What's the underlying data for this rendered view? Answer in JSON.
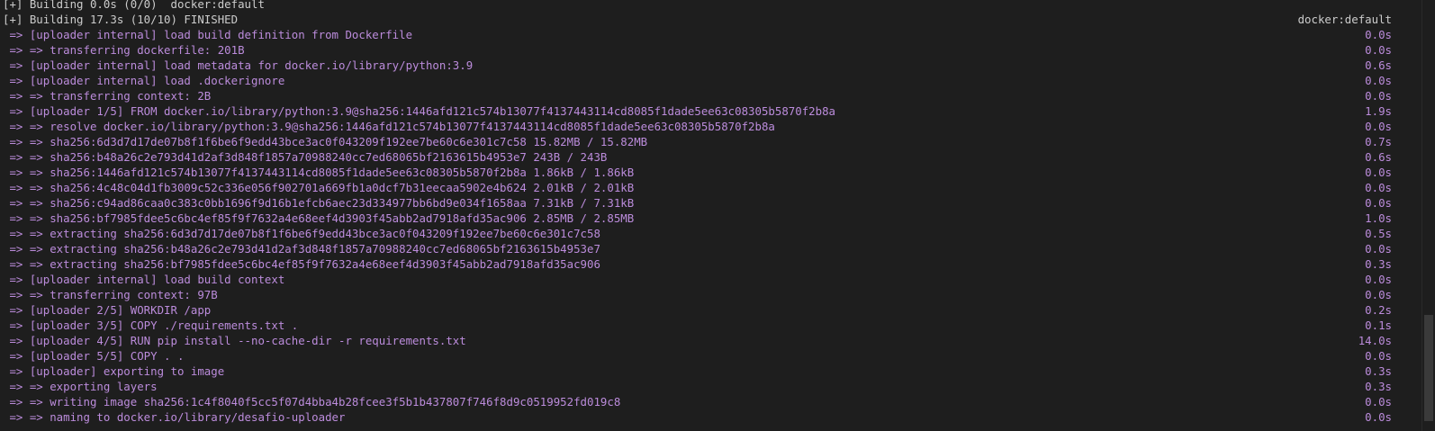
{
  "terminal": {
    "lines": [
      {
        "text": "[+] Building 0.0s (0/0)  docker:default",
        "time": "",
        "tone": "white"
      },
      {
        "text": "[+] Building 17.3s (10/10) FINISHED",
        "time": "docker:default",
        "tone": "white"
      },
      {
        "text": " => [uploader internal] load build definition from Dockerfile",
        "time": "0.0s",
        "tone": "purple"
      },
      {
        "text": " => => transferring dockerfile: 201B",
        "time": "0.0s",
        "tone": "purple"
      },
      {
        "text": " => [uploader internal] load metadata for docker.io/library/python:3.9",
        "time": "0.6s",
        "tone": "purple"
      },
      {
        "text": " => [uploader internal] load .dockerignore",
        "time": "0.0s",
        "tone": "purple"
      },
      {
        "text": " => => transferring context: 2B",
        "time": "0.0s",
        "tone": "purple"
      },
      {
        "text": " => [uploader 1/5] FROM docker.io/library/python:3.9@sha256:1446afd121c574b13077f4137443114cd8085f1dade5ee63c08305b5870f2b8a",
        "time": "1.9s",
        "tone": "purple"
      },
      {
        "text": " => => resolve docker.io/library/python:3.9@sha256:1446afd121c574b13077f4137443114cd8085f1dade5ee63c08305b5870f2b8a",
        "time": "0.0s",
        "tone": "purple"
      },
      {
        "text": " => => sha256:6d3d7d17de07b8f1f6be6f9edd43bce3ac0f043209f192ee7be60c6e301c7c58 15.82MB / 15.82MB",
        "time": "0.7s",
        "tone": "purple"
      },
      {
        "text": " => => sha256:b48a26c2e793d41d2af3d848f1857a70988240cc7ed68065bf2163615b4953e7 243B / 243B",
        "time": "0.6s",
        "tone": "purple"
      },
      {
        "text": " => => sha256:1446afd121c574b13077f4137443114cd8085f1dade5ee63c08305b5870f2b8a 1.86kB / 1.86kB",
        "time": "0.0s",
        "tone": "purple"
      },
      {
        "text": " => => sha256:4c48c04d1fb3009c52c336e056f902701a669fb1a0dcf7b31eecaa5902e4b624 2.01kB / 2.01kB",
        "time": "0.0s",
        "tone": "purple"
      },
      {
        "text": " => => sha256:c94ad86caa0c383c0bb1696f9d16b1efcb6aec23d334977bb6bd9e034f1658aa 7.31kB / 7.31kB",
        "time": "0.0s",
        "tone": "purple"
      },
      {
        "text": " => => sha256:bf7985fdee5c6bc4ef85f9f7632a4e68eef4d3903f45abb2ad7918afd35ac906 2.85MB / 2.85MB",
        "time": "1.0s",
        "tone": "purple"
      },
      {
        "text": " => => extracting sha256:6d3d7d17de07b8f1f6be6f9edd43bce3ac0f043209f192ee7be60c6e301c7c58",
        "time": "0.5s",
        "tone": "purple"
      },
      {
        "text": " => => extracting sha256:b48a26c2e793d41d2af3d848f1857a70988240cc7ed68065bf2163615b4953e7",
        "time": "0.0s",
        "tone": "purple"
      },
      {
        "text": " => => extracting sha256:bf7985fdee5c6bc4ef85f9f7632a4e68eef4d3903f45abb2ad7918afd35ac906",
        "time": "0.3s",
        "tone": "purple"
      },
      {
        "text": " => [uploader internal] load build context",
        "time": "0.0s",
        "tone": "purple"
      },
      {
        "text": " => => transferring context: 97B",
        "time": "0.0s",
        "tone": "purple"
      },
      {
        "text": " => [uploader 2/5] WORKDIR /app",
        "time": "0.2s",
        "tone": "purple"
      },
      {
        "text": " => [uploader 3/5] COPY ./requirements.txt .",
        "time": "0.1s",
        "tone": "purple"
      },
      {
        "text": " => [uploader 4/5] RUN pip install --no-cache-dir -r requirements.txt",
        "time": "14.0s",
        "tone": "purple"
      },
      {
        "text": " => [uploader 5/5] COPY . .",
        "time": "0.0s",
        "tone": "purple"
      },
      {
        "text": " => [uploader] exporting to image",
        "time": "0.3s",
        "tone": "purple"
      },
      {
        "text": " => => exporting layers",
        "time": "0.3s",
        "tone": "purple"
      },
      {
        "text": " => => writing image sha256:1c4f8040f5cc5f07d4bba4b28fcee3f5b1b437807f746f8d9c0519952fd019c8",
        "time": "0.0s",
        "tone": "purple"
      },
      {
        "text": " => => naming to docker.io/library/desafio-uploader",
        "time": "0.0s",
        "tone": "purple"
      }
    ],
    "colors": {
      "background": "#1e1e1e",
      "text": "#cccccc",
      "output": "#bc8cdc",
      "cursor": "#ff2ea7"
    }
  }
}
